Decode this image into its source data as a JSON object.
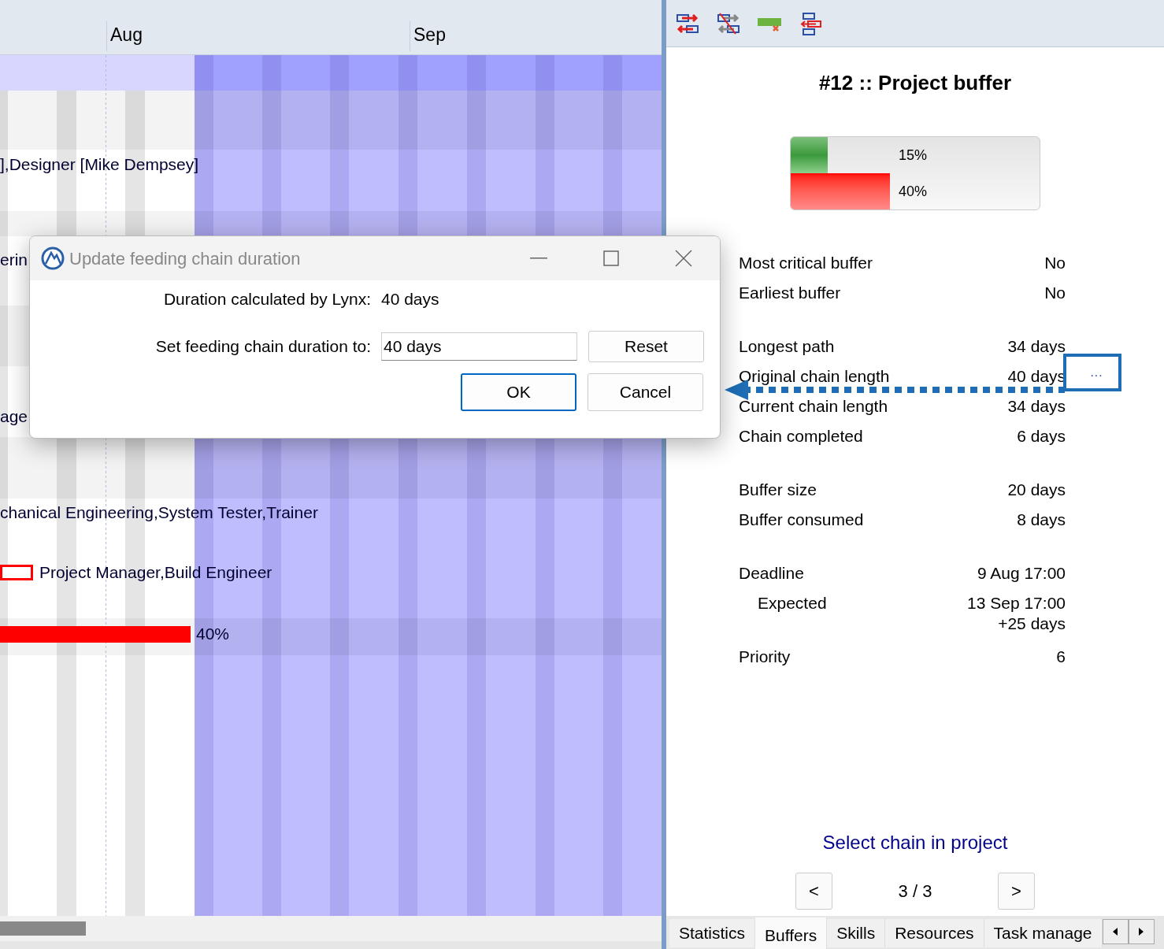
{
  "gantt": {
    "months": [
      "Aug",
      "Sep"
    ],
    "rows": [
      {
        "kind": "task",
        "text": "],Designer [Mike Dempsey]"
      },
      {
        "kind": "task",
        "text": "erin"
      },
      {
        "kind": "task",
        "text": "age"
      },
      {
        "kind": "task",
        "text": "chanical Engineering,System Tester,Trainer"
      },
      {
        "kind": "milestone",
        "text": "Project Manager,Build Engineer"
      },
      {
        "kind": "buffer",
        "text": "40%"
      }
    ]
  },
  "dialog": {
    "title": "Update feeding chain duration",
    "calculated_label": "Duration calculated by Lynx:",
    "calculated_value": "40 days",
    "set_label": "Set feeding chain duration to:",
    "set_value": "40 days",
    "buttons": [
      {
        "label": "Reset",
        "default": false
      },
      {
        "label": "OK",
        "default": true
      },
      {
        "label": "Cancel",
        "default": false
      }
    ]
  },
  "panel": {
    "title": "#12 :: Project buffer",
    "meter": [
      {
        "kind": "chain",
        "level": 0.15,
        "reading": "15%"
      },
      {
        "kind": "buffer",
        "level": 0.4,
        "reading": "40%"
      }
    ],
    "groups": [
      [
        {
          "label": "Most critical buffer",
          "value": "No"
        },
        {
          "label": "Earliest buffer",
          "value": "No"
        }
      ],
      [
        {
          "label": "Longest path",
          "value": "34 days"
        },
        {
          "label": "Original chain length",
          "value": "40 days",
          "edit": "···"
        },
        {
          "label": "Current chain length",
          "value": "34 days"
        },
        {
          "label": "Chain completed",
          "value": "6 days"
        }
      ],
      [
        {
          "label": "Buffer size",
          "value": "20 days"
        },
        {
          "label": "Buffer consumed",
          "value": "8 days"
        }
      ],
      [
        {
          "label": "Deadline",
          "value": "9 Aug 17:00",
          "children": [
            {
              "label": "Expected",
              "value": "13 Sep 17:00",
              "note": "+25 days"
            }
          ]
        }
      ],
      [
        {
          "label": "Priority",
          "value": "6"
        }
      ]
    ],
    "link": "Select chain in project",
    "prev": "<",
    "next": ">",
    "page": "3 / 3",
    "tabs": [
      {
        "label": "Statistics",
        "selected": false
      },
      {
        "label": "Buffers",
        "selected": true
      },
      {
        "label": "Skills",
        "selected": false
      },
      {
        "label": "Resources",
        "selected": false
      },
      {
        "label": "Task manage",
        "selected": false
      }
    ]
  }
}
